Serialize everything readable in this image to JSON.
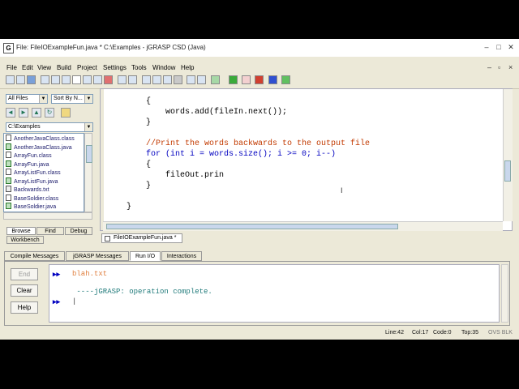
{
  "window": {
    "title": "File: FileIOExampleFun.java *  C:\\Examples - jGRASP CSD (Java)"
  },
  "menu": [
    "File",
    "Edit",
    "View",
    "Build",
    "Project",
    "Settings",
    "Tools",
    "Window",
    "Help"
  ],
  "left_panel": {
    "filter": "All Files",
    "sort": "Sort By N...",
    "path": "C:\\Examples",
    "files": [
      {
        "name": "AnotherJavaClass.class",
        "type": "cls"
      },
      {
        "name": "AnotherJavaClass.java",
        "type": "java"
      },
      {
        "name": "ArrayFun.class",
        "type": "cls"
      },
      {
        "name": "ArrayFun.java",
        "type": "java"
      },
      {
        "name": "ArrayListFun.class",
        "type": "cls"
      },
      {
        "name": "ArrayListFun.java",
        "type": "java"
      },
      {
        "name": "Backwards.txt",
        "type": "txt"
      },
      {
        "name": "BaseSoldier.class",
        "type": "cls"
      },
      {
        "name": "BaseSoldier.java",
        "type": "java"
      }
    ],
    "tabs": [
      "Browse",
      "Find",
      "Debug",
      "Workbench"
    ]
  },
  "editor": {
    "lines": [
      "        {",
      "            words.add(fileIn.next());",
      "        }",
      "",
      "        //Print the words backwards to the output file",
      "        for (int i = words.size(); i >= 0; i--)",
      "        {",
      "            fileOut.prin",
      "        }",
      "",
      "    }"
    ],
    "tab": "FileIOExampleFun.java *"
  },
  "bottom": {
    "tabs": [
      "Compile Messages",
      "jGRASP Messages",
      "Run I/O",
      "Interactions"
    ],
    "active_tab": "Run I/O",
    "buttons": {
      "end": "End",
      "clear": "Clear",
      "help": "Help"
    },
    "output": {
      "prompt": "▸▸",
      "lines": [
        "blah.txt",
        "",
        " ----jGRASP: operation complete."
      ]
    }
  },
  "status": {
    "line": "Line:42",
    "col": "Col:17",
    "code": "Code:0",
    "top": "Top:35",
    "flags": "OVS BLK"
  },
  "colors": {
    "comment": "#c23a00",
    "keyword": "#0000c0",
    "output_text": "#1f7a7a"
  }
}
